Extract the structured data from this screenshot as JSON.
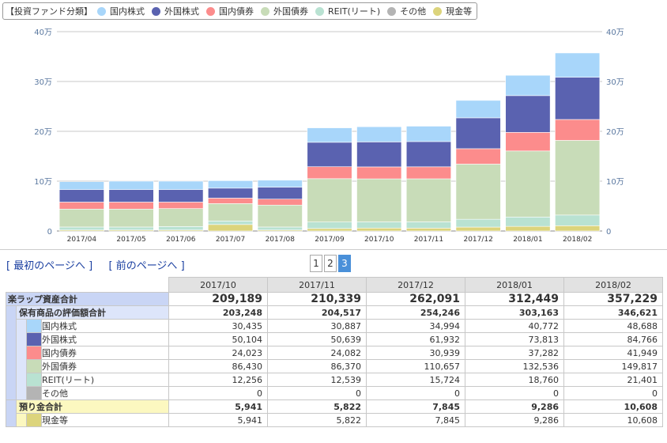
{
  "legend": {
    "title": "【投資ファンド分類】",
    "items": [
      {
        "label": "国内株式",
        "color": "#a8d6fa"
      },
      {
        "label": "外国株式",
        "color": "#5a62b0"
      },
      {
        "label": "国内債券",
        "color": "#fc8c8c"
      },
      {
        "label": "外国債券",
        "color": "#c8dcb8"
      },
      {
        "label": "REIT(リート)",
        "color": "#b9e2d2"
      },
      {
        "label": "その他",
        "color": "#b4b4b4"
      },
      {
        "label": "現金等",
        "color": "#dcd47c"
      }
    ]
  },
  "chart_data": {
    "type": "bar",
    "stacked": true,
    "categories": [
      "2017/04",
      "2017/05",
      "2017/06",
      "2017/07",
      "2017/08",
      "2017/09",
      "2017/10",
      "2017/11",
      "2017/12",
      "2018/01",
      "2018/02"
    ],
    "ylim": [
      0,
      400000
    ],
    "yticks": [
      {
        "value": 0,
        "label": "0"
      },
      {
        "value": 100000,
        "label": "10万"
      },
      {
        "value": 200000,
        "label": "20万"
      },
      {
        "value": 300000,
        "label": "30万"
      },
      {
        "value": 400000,
        "label": "40万"
      }
    ],
    "grid": "horizontal",
    "legend_position": "top-left",
    "series": [
      {
        "name": "現金等",
        "color": "#dcd47c",
        "values": [
          2000,
          2000,
          2000,
          13000,
          2000,
          5000,
          5941,
          5822,
          7845,
          9286,
          10608
        ]
      },
      {
        "name": "その他",
        "color": "#b4b4b4",
        "values": [
          0,
          0,
          0,
          0,
          0,
          0,
          0,
          0,
          0,
          0,
          0
        ]
      },
      {
        "name": "REIT(リート)",
        "color": "#b9e2d2",
        "values": [
          6000,
          6000,
          7000,
          7000,
          6000,
          13000,
          12256,
          12539,
          15724,
          18760,
          21401
        ]
      },
      {
        "name": "外国債券",
        "color": "#c8dcb8",
        "values": [
          36000,
          36000,
          36000,
          35000,
          44000,
          87000,
          86430,
          86370,
          110657,
          132536,
          149817
        ]
      },
      {
        "name": "国内債券",
        "color": "#fc8c8c",
        "values": [
          14000,
          14000,
          13000,
          11000,
          12000,
          24000,
          24023,
          24082,
          30939,
          37282,
          41949
        ]
      },
      {
        "name": "外国株式",
        "color": "#5a62b0",
        "values": [
          25000,
          25000,
          25000,
          20000,
          24000,
          49000,
          50104,
          50639,
          61932,
          73813,
          84766
        ]
      },
      {
        "name": "国内株式",
        "color": "#a8d6fa",
        "values": [
          16000,
          17000,
          17000,
          15000,
          14000,
          29000,
          30435,
          30887,
          34994,
          40772,
          48688
        ]
      }
    ]
  },
  "nav": {
    "first_label": "最初のページへ",
    "prev_label": "前のページへ",
    "bracket_open": "[",
    "bracket_close": "]",
    "pages": [
      "1",
      "2",
      "3"
    ],
    "current_page": "3"
  },
  "table": {
    "columns": [
      "2017/10",
      "2017/11",
      "2017/12",
      "2018/01",
      "2018/02"
    ],
    "total": {
      "label": "楽ラップ資産合計",
      "values": [
        "209,189",
        "210,339",
        "262,091",
        "312,449",
        "357,229"
      ]
    },
    "holdings": {
      "label": "保有商品の評価額合計",
      "values": [
        "203,248",
        "204,517",
        "254,246",
        "303,163",
        "346,621"
      ]
    },
    "categories": [
      {
        "label": "国内株式",
        "color": "#a8d6fa",
        "values": [
          "30,435",
          "30,887",
          "34,994",
          "40,772",
          "48,688"
        ]
      },
      {
        "label": "外国株式",
        "color": "#5a62b0",
        "values": [
          "50,104",
          "50,639",
          "61,932",
          "73,813",
          "84,766"
        ]
      },
      {
        "label": "国内債券",
        "color": "#fc8c8c",
        "values": [
          "24,023",
          "24,082",
          "30,939",
          "37,282",
          "41,949"
        ]
      },
      {
        "label": "外国債券",
        "color": "#c8dcb8",
        "values": [
          "86,430",
          "86,370",
          "110,657",
          "132,536",
          "149,817"
        ]
      },
      {
        "label": "REIT(リート)",
        "color": "#b9e2d2",
        "values": [
          "12,256",
          "12,539",
          "15,724",
          "18,760",
          "21,401"
        ]
      },
      {
        "label": "その他",
        "color": "#b4b4b4",
        "values": [
          "0",
          "0",
          "0",
          "0",
          "0"
        ]
      }
    ],
    "deposit": {
      "label": "預り金合計",
      "values": [
        "5,941",
        "5,822",
        "7,845",
        "9,286",
        "10,608"
      ]
    },
    "cash": {
      "label": "現金等",
      "color": "#dcd47c",
      "values": [
        "5,941",
        "5,822",
        "7,845",
        "9,286",
        "10,608"
      ]
    }
  }
}
